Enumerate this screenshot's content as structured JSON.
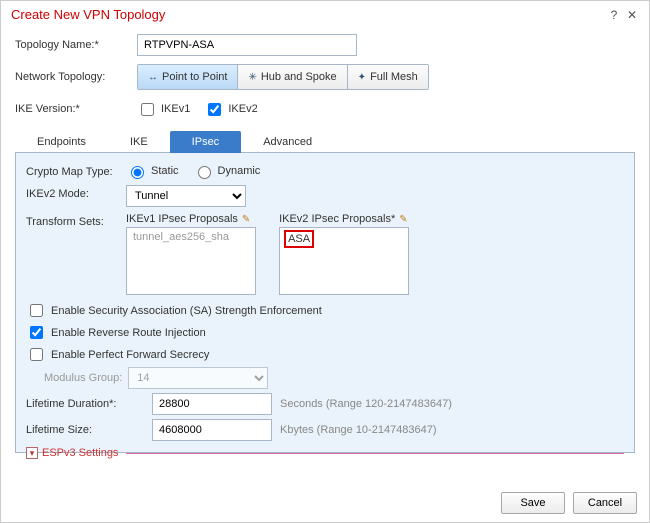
{
  "dialog": {
    "title": "Create New VPN Topology",
    "help_icon": "?",
    "close_icon": "✕"
  },
  "form": {
    "topology_name_label": "Topology Name:*",
    "topology_name_value": "RTPVPN-ASA",
    "network_topology_label": "Network Topology:",
    "topo_buttons": {
      "p2p": "Point to Point",
      "hub": "Hub and Spoke",
      "mesh": "Full Mesh"
    },
    "ike_version_label": "IKE Version:*",
    "ikev1_label": "IKEv1",
    "ikev2_label": "IKEv2"
  },
  "tabs": {
    "endpoints": "Endpoints",
    "ike": "IKE",
    "ipsec": "IPsec",
    "advanced": "Advanced"
  },
  "ipsec": {
    "crypto_map_label": "Crypto Map Type:",
    "crypto_static": "Static",
    "crypto_dynamic": "Dynamic",
    "ikev2_mode_label": "IKEv2 Mode:",
    "ikev2_mode_value": "Tunnel",
    "transform_sets_label": "Transform Sets:",
    "ikev1_proposals_label": "IKEv1 IPsec Proposals",
    "ikev1_item": "tunnel_aes256_sha",
    "ikev2_proposals_label": "IKEv2 IPsec Proposals*",
    "ikev2_item": "ASA",
    "enable_sa": "Enable Security Association (SA) Strength Enforcement",
    "enable_rri": "Enable Reverse Route Injection",
    "enable_pfs": "Enable Perfect Forward Secrecy",
    "modulus_label": "Modulus Group:",
    "modulus_value": "14",
    "lifetime_duration_label": "Lifetime Duration*:",
    "lifetime_duration_value": "28800",
    "lifetime_duration_hint": "Seconds (Range 120-2147483647)",
    "lifetime_size_label": "Lifetime Size:",
    "lifetime_size_value": "4608000",
    "lifetime_size_hint": "Kbytes (Range 10-2147483647)",
    "esp_toggle": "▾",
    "esp_title": "ESPv3 Settings"
  },
  "footer": {
    "save": "Save",
    "cancel": "Cancel"
  }
}
